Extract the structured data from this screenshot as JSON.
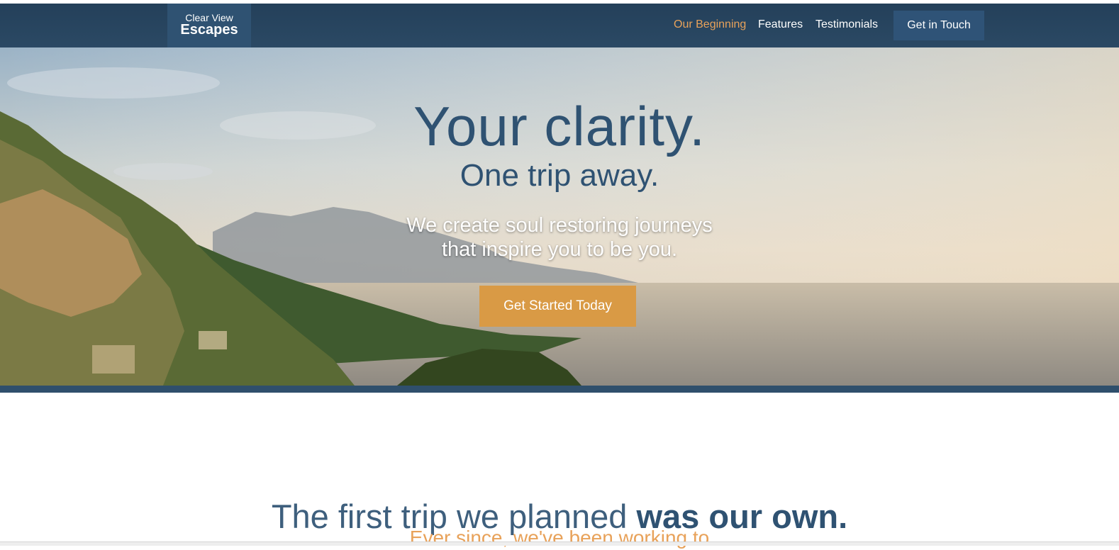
{
  "nav": {
    "logo_line1": "Clear View",
    "logo_line2": "Escapes",
    "links": [
      "Our Beginning",
      "Features",
      "Testimonials"
    ],
    "active_index": 0,
    "cta_label": "Get in Touch"
  },
  "hero": {
    "title": "Your clarity.",
    "subtitle": "One trip away.",
    "description_line1": "We create soul restoring journeys",
    "description_line2": "that inspire you to be you.",
    "cta_label": "Get Started Today"
  },
  "section": {
    "title_light": "The first trip we planned ",
    "title_bold": "was our own.",
    "subtitle_partial": "Ever since, we've been working to"
  },
  "colors": {
    "navbar": "#24405a",
    "accent_orange": "#d99a45",
    "brand_blue": "#2f5272",
    "active_link": "#e8a25a"
  }
}
